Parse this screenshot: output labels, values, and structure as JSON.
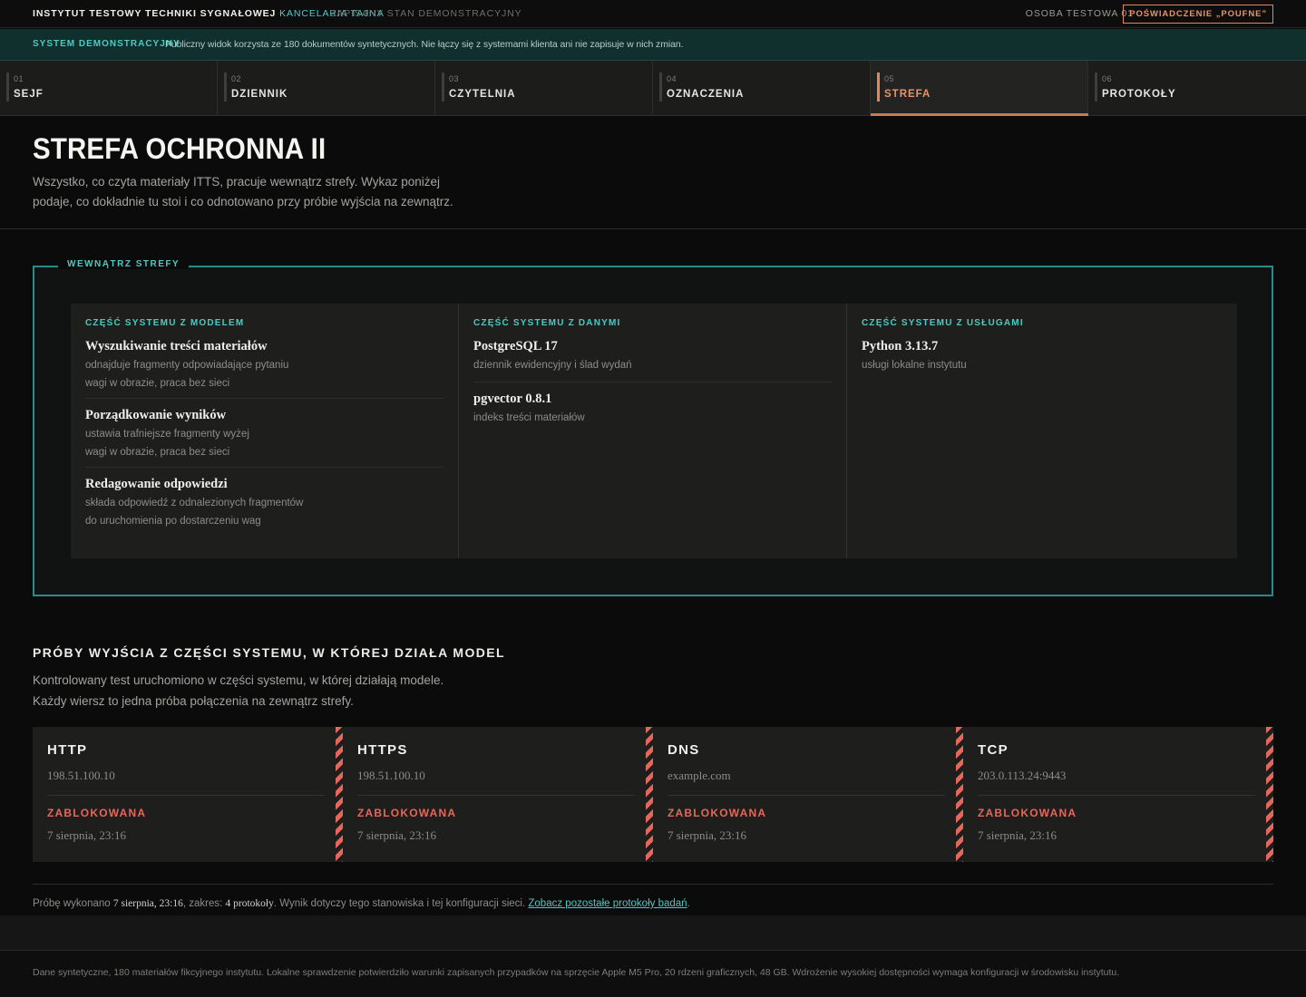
{
  "topbar": {
    "org": "INSTYTUT TESTOWY TECHNIKI SYGNAŁOWEJ",
    "office": "KANCELARIA TAJNA",
    "state": "ZAPISANY STAN DEMONSTRACYJNY",
    "person": "OSOBA TESTOWA 01",
    "clearance": "POŚWIADCZENIE „POUFNE”"
  },
  "banner": {
    "tag": "SYSTEM DEMONSTRACYJNY",
    "message": "Publiczny widok korzysta ze 180 dokumentów syntetycznych. Nie łączy się z systemami klienta ani nie zapisuje w nich zmian."
  },
  "tabs": [
    {
      "num": "01",
      "label": "SEJF"
    },
    {
      "num": "02",
      "label": "DZIENNIK"
    },
    {
      "num": "03",
      "label": "CZYTELNIA"
    },
    {
      "num": "04",
      "label": "OZNACZENIA"
    },
    {
      "num": "05",
      "label": "STREFA"
    },
    {
      "num": "06",
      "label": "PROTOKOŁY"
    }
  ],
  "active_tab": "STREFA",
  "page": {
    "title": "STREFA OCHRONNA II",
    "description": "Wszystko, co czyta materiały ITTS, pracuje wewnątrz strefy. Wykaz poniżej podaje, co dokładnie tu stoi i co odnotowano przy próbie wyjścia na zewnątrz."
  },
  "zone": {
    "legend": "WEWNĄTRZ STREFY",
    "columns": [
      {
        "heading": "CZĘŚĆ SYSTEMU Z MODELEM",
        "items": [
          {
            "name": "Wyszukiwanie treści materiałów",
            "desc": "odnajduje fragmenty odpowiadające pytaniu",
            "note": "wagi w obrazie, praca bez sieci"
          },
          {
            "name": "Porządkowanie wyników",
            "desc": "ustawia trafniejsze fragmenty wyżej",
            "note": "wagi w obrazie, praca bez sieci"
          },
          {
            "name": "Redagowanie odpowiedzi",
            "desc": "składa odpowiedź z odnalezionych fragmentów",
            "note": "do uruchomienia po dostarczeniu wag"
          }
        ]
      },
      {
        "heading": "CZĘŚĆ SYSTEMU Z DANYMI",
        "items": [
          {
            "name": "PostgreSQL 17",
            "desc": "dziennik ewidencyjny i ślad wydań"
          },
          {
            "name": "pgvector 0.8.1",
            "desc": "indeks treści materiałów"
          }
        ]
      },
      {
        "heading": "CZĘŚĆ SYSTEMU Z USŁUGAMI",
        "items": [
          {
            "name": "Python 3.13.7",
            "desc": "usługi lokalne instytutu"
          }
        ]
      }
    ]
  },
  "egress": {
    "title": "PRÓBY WYJŚCIA Z CZĘŚCI SYSTEMU, W KTÓREJ DZIAŁA MODEL",
    "description": "Kontrolowany test uruchomiono w części systemu, w której działają modele. Każdy wiersz to jedna próba połączenia na zewnątrz strefy.",
    "attempts": [
      {
        "protocol": "HTTP",
        "target": "198.51.100.10",
        "status": "ZABLOKOWANA",
        "time": "7 sierpnia, 23:16"
      },
      {
        "protocol": "HTTPS",
        "target": "198.51.100.10",
        "status": "ZABLOKOWANA",
        "time": "7 sierpnia, 23:16"
      },
      {
        "protocol": "DNS",
        "target": "example.com",
        "status": "ZABLOKOWANA",
        "time": "7 sierpnia, 23:16"
      },
      {
        "protocol": "TCP",
        "target": "203.0.113.24:9443",
        "status": "ZABLOKOWANA",
        "time": "7 sierpnia, 23:16"
      }
    ]
  },
  "summary": {
    "prefix": "Próbę wykonano",
    "date": "7 sierpnia, 23:16",
    "scope_label": ", zakres:",
    "scope": "4 protokoły",
    "suffix": ". Wynik dotyczy tego stanowiska i tej konfiguracji sieci.",
    "link": "Zobacz pozostałe protokoły badań",
    "end": "."
  },
  "footer": {
    "text": "Dane syntetyczne, 180 materiałów fikcyjnego instytutu. Lokalne sprawdzenie potwierdziło warunki zapisanych przypadków na sprzęcie Apple M5 Pro, 20 rdzeni graficznych, 48 GB. Wdrożenie wysokiej dostępności wymaga konfiguracji w środowisku instytutu."
  },
  "colors": {
    "accent_teal": "#4ec9c3",
    "accent_orange": "#e0875b",
    "blocked_red": "#e5675b",
    "background": "#0b0b0b"
  }
}
